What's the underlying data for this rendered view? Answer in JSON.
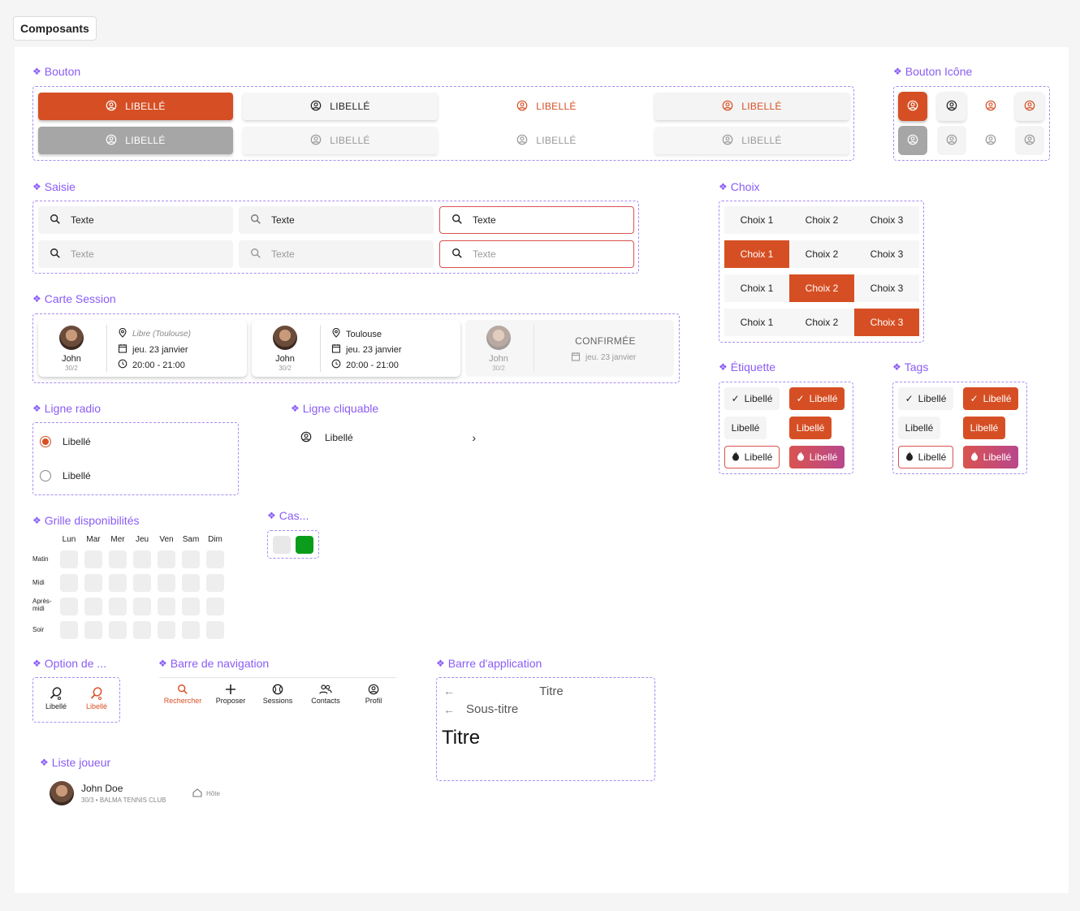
{
  "page_title": "Composants",
  "colors": {
    "accent": "#d64f24",
    "section": "#8a5cf6",
    "success": "#0a9c1a"
  },
  "sections": {
    "bouton": "Bouton",
    "bouton_icone": "Bouton Icône",
    "saisie": "Saisie",
    "choix": "Choix",
    "carte_session": "Carte Session",
    "etiquette": "Étiquette",
    "tags": "Tags",
    "ligne_radio": "Ligne radio",
    "ligne_cliquable": "Ligne cliquable",
    "grille": "Grille disponibilités",
    "cas": "Cas...",
    "option": "Option de ...",
    "barre_nav": "Barre de navigation",
    "barre_app": "Barre d'application",
    "liste_joueur": "Liste joueur"
  },
  "button_label": "LIBELLÉ",
  "input_text": "Texte",
  "choices": [
    "Choix 1",
    "Choix 2",
    "Choix 3"
  ],
  "selected_choice_per_row": [
    null,
    0,
    1,
    2
  ],
  "cards": [
    {
      "name": "John",
      "rank": "30/2",
      "location": "Libre (Toulouse)",
      "date": "jeu. 23 janvier",
      "time": "20:00 - 21:00"
    },
    {
      "name": "John",
      "rank": "30/2",
      "location": "Toulouse",
      "date": "jeu. 23 janvier",
      "time": "20:00 - 21:00"
    },
    {
      "name": "John",
      "rank": "30/2",
      "status": "CONFIRMÉE",
      "date": "jeu. 23 janvier"
    }
  ],
  "tag_label": "Libellé",
  "radio": {
    "items": [
      "Libellé",
      "Libellé"
    ],
    "selected": 0
  },
  "clickable_row": {
    "label": "Libellé"
  },
  "grid": {
    "days": [
      "Lun",
      "Mar",
      "Mer",
      "Jeu",
      "Ven",
      "Sam",
      "Dim"
    ],
    "slots": [
      "Matin",
      "Midi",
      "Après-\nmidi",
      "Soir"
    ]
  },
  "option": {
    "items": [
      "Libellé",
      "Libellé"
    ]
  },
  "nav": {
    "items": [
      "Rechercher",
      "Proposer",
      "Sessions",
      "Contacts",
      "Profil"
    ],
    "active": 0
  },
  "appbar": {
    "title_small": "Titre",
    "subtitle": "Sous-titre",
    "title_large": "Titre"
  },
  "player": {
    "name": "John Doe",
    "details": "30/3 • BALMA TENNIS CLUB",
    "role": "Hôte"
  }
}
